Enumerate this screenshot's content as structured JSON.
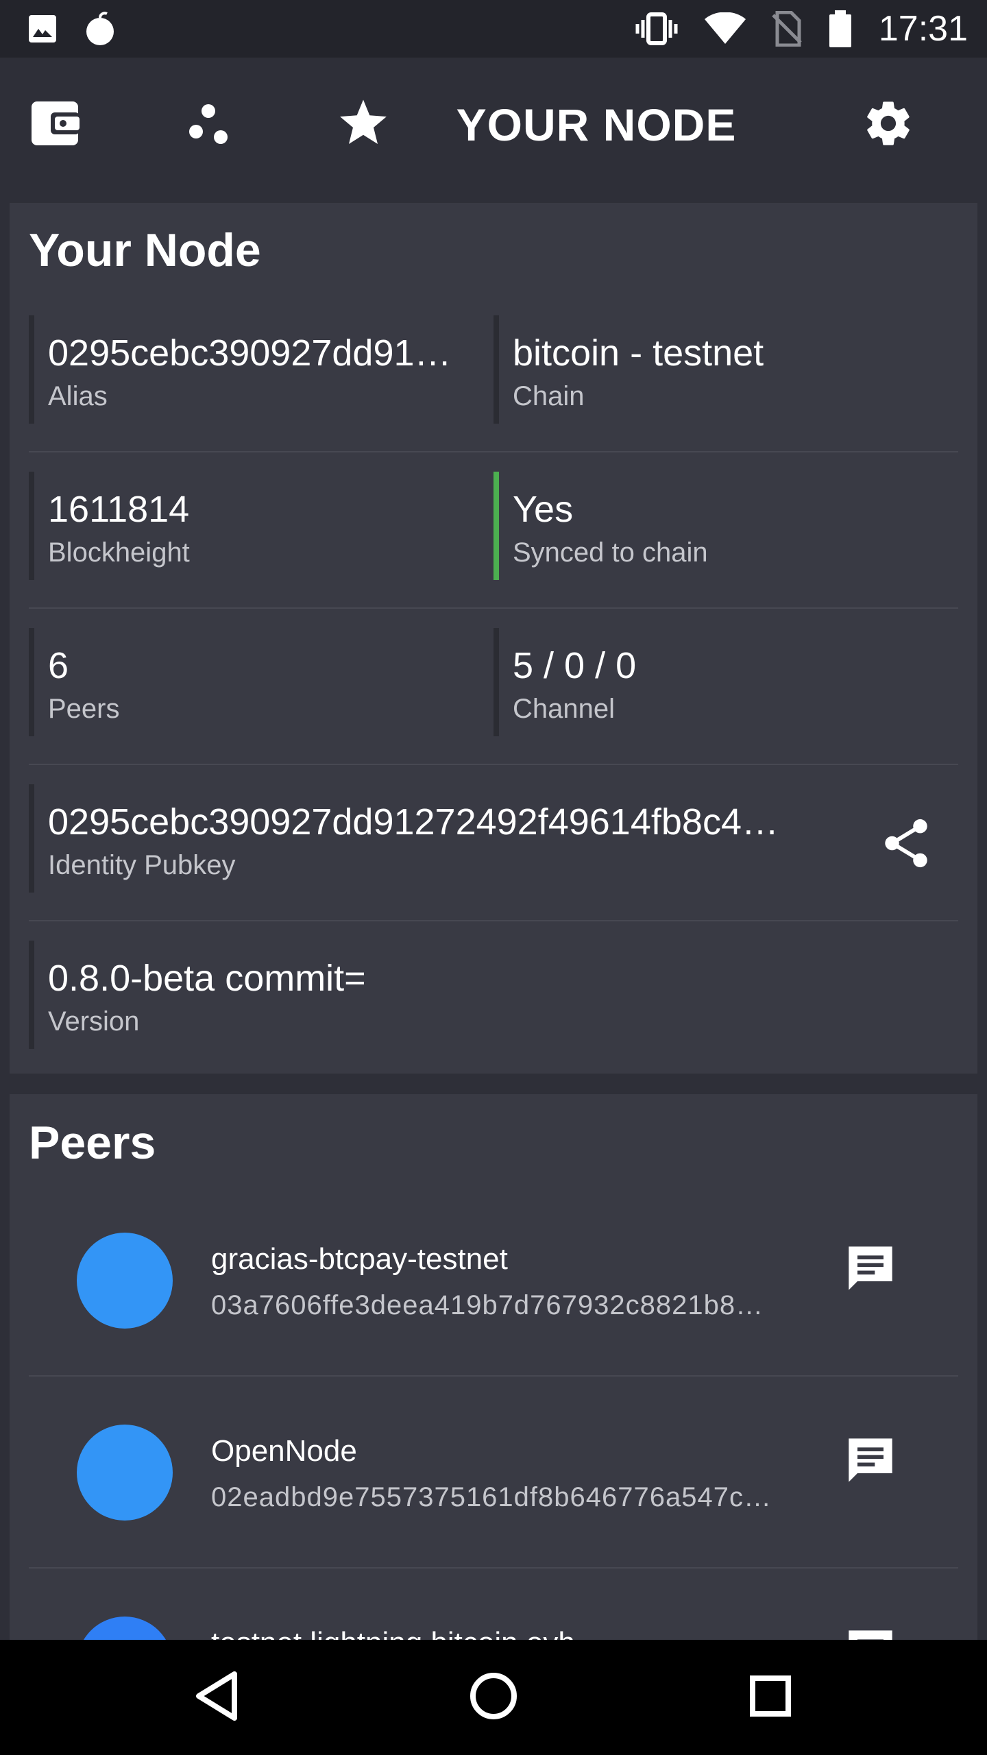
{
  "status_bar": {
    "time": "17:31",
    "left_icons": [
      "image-icon",
      "bomb-icon"
    ],
    "right_icons": [
      "vibrate-icon",
      "wifi-icon",
      "no-sim-icon",
      "battery-icon"
    ]
  },
  "app_bar": {
    "title": "YOUR NODE",
    "icons": [
      "wallet-icon",
      "peers-network-icon",
      "star-icon",
      "settings-gear-icon"
    ]
  },
  "node_card": {
    "title": "Your Node",
    "alias": {
      "value": "0295cebc390927dd91…",
      "label": "Alias"
    },
    "chain": {
      "value": "bitcoin - testnet",
      "label": "Chain"
    },
    "blockheight": {
      "value": "1611814",
      "label": "Blockheight"
    },
    "synced": {
      "value": "Yes",
      "label": "Synced to chain",
      "status_color": "#4caf50"
    },
    "peers": {
      "value": "6",
      "label": "Peers"
    },
    "channel": {
      "value": "5 / 0 / 0",
      "label": "Channel"
    },
    "pubkey": {
      "value": "0295cebc390927dd91272492f49614fb8c4…",
      "label": "Identity Pubkey"
    },
    "version": {
      "value": "0.8.0-beta commit=",
      "label": "Version"
    }
  },
  "peers_card": {
    "title": "Peers",
    "items": [
      {
        "name": "gracias-btcpay-testnet",
        "pubkey": "03a7606ffe3deea419b7d767932c8821b8…"
      },
      {
        "name": "OpenNode",
        "pubkey": "02eadbd9e7557375161df8b646776a547c…"
      },
      {
        "name": "testnet.lightning.bitcoin.ovh",
        "pubkey": ""
      }
    ]
  },
  "colors": {
    "background": "#2e2f38",
    "card": "#393a44",
    "status_bar": "#23242b",
    "avatar": "#3395f6",
    "synced": "#4caf50"
  },
  "nav_bar": {
    "icons": [
      "back-icon",
      "home-icon",
      "recents-icon"
    ]
  }
}
